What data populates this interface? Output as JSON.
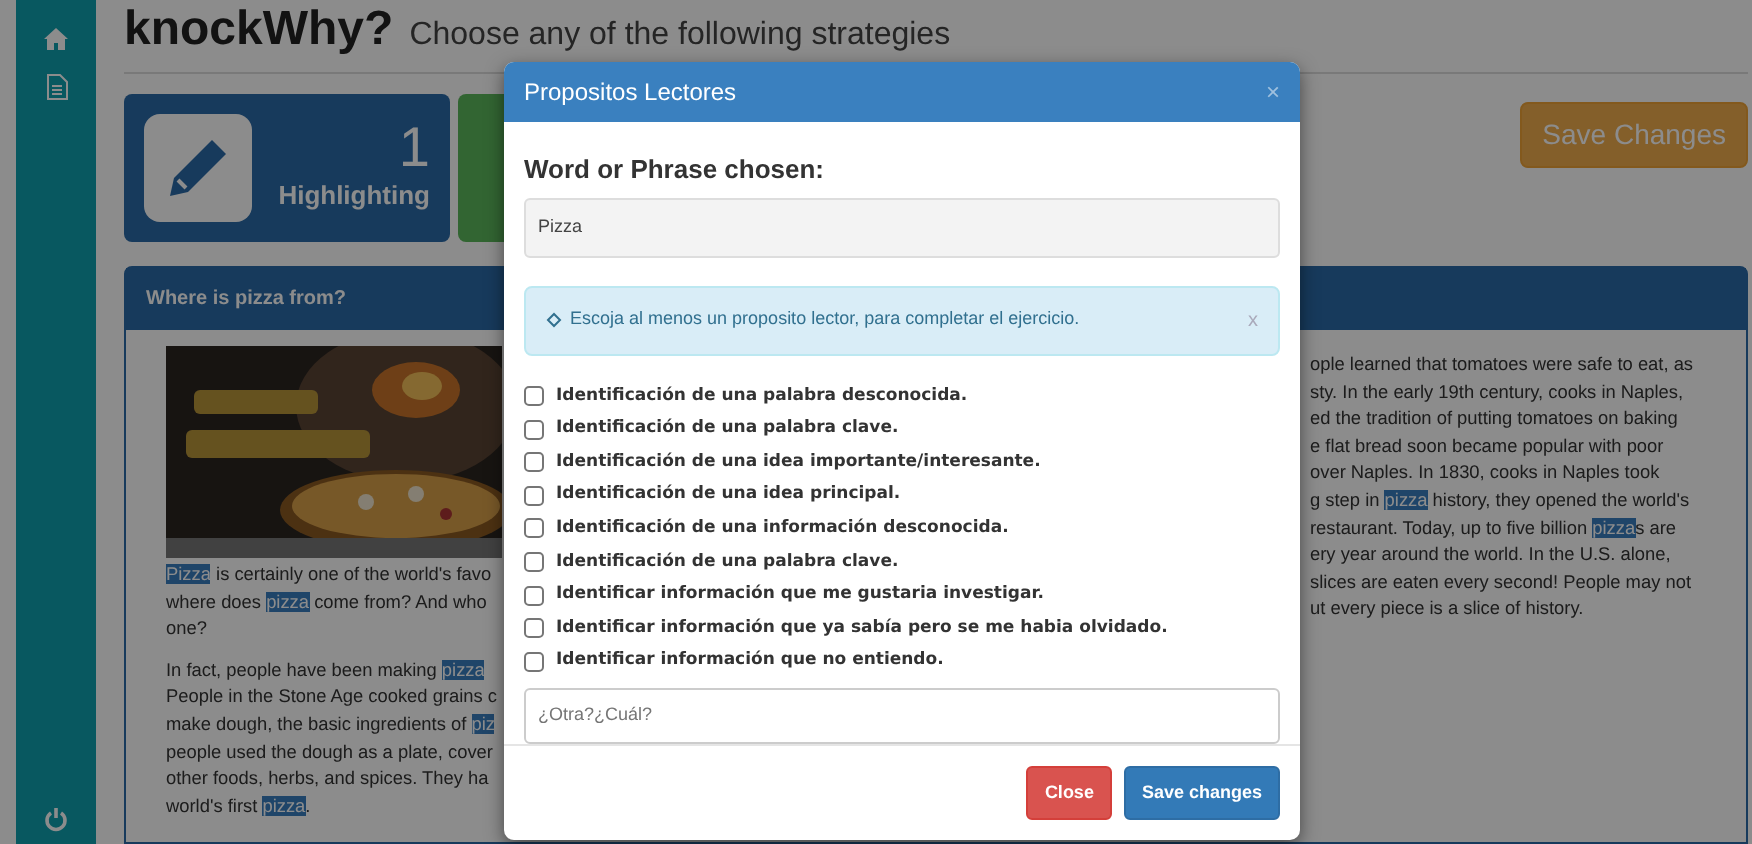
{
  "header": {
    "title": "knockWhy?",
    "subtitle": "Choose any of the following strategies"
  },
  "strategy_cards": [
    {
      "count": "1",
      "label": "Highlighting"
    }
  ],
  "save_button": {
    "label": "Save Changes"
  },
  "panel": {
    "title": "Where is pizza from?",
    "image": {
      "kind": "picture"
    },
    "left_paragraphs": [
      [
        [
          {
            "text": "Pizza",
            "highlighted": true
          },
          {
            "text": " is certainly one of the world's favo",
            "highlighted": false
          }
        ],
        [
          {
            "text": "where does ",
            "highlighted": false
          },
          {
            "text": "pizza",
            "highlighted": true
          },
          {
            "text": " come from? And who",
            "highlighted": false
          }
        ],
        [
          {
            "text": "one?",
            "highlighted": false
          }
        ]
      ],
      [
        [
          {
            "text": "In fact, people have been making ",
            "highlighted": false
          },
          {
            "text": "pizza",
            "highlighted": true
          }
        ],
        [
          {
            "text": "People in the Stone Age cooked grains c",
            "highlighted": false
          }
        ],
        [
          {
            "text": "make dough, the basic ingredients of ",
            "highlighted": false
          },
          {
            "text": "piz",
            "highlighted": true
          }
        ],
        [
          {
            "text": "people used the dough as a plate, cover",
            "highlighted": false
          }
        ],
        [
          {
            "text": "other foods, herbs, and spices. They ha",
            "highlighted": false
          }
        ],
        [
          {
            "text": "world's first ",
            "highlighted": false
          },
          {
            "text": "pizza",
            "highlighted": true
          },
          {
            "text": ".",
            "highlighted": false
          }
        ]
      ]
    ],
    "right_lines": [
      [
        {
          "text": "ople learned that tomatoes were safe to eat, as",
          "highlighted": false
        }
      ],
      [
        {
          "text": "sty. In the early 19th century, cooks in Naples,",
          "highlighted": false
        }
      ],
      [
        {
          "text": "ed the tradition of putting tomatoes on baking",
          "highlighted": false
        }
      ],
      [
        {
          "text": "e flat bread soon became popular with poor",
          "highlighted": false
        }
      ],
      [
        {
          "text": "over Naples. In 1830, cooks in Naples took",
          "highlighted": false
        }
      ],
      [
        {
          "text": "g step in ",
          "highlighted": false
        },
        {
          "text": "pizza",
          "highlighted": true
        },
        {
          "text": " history, they opened the world's",
          "highlighted": false
        }
      ],
      [
        {
          "text": "restaurant. Today, up to five billion ",
          "highlighted": false
        },
        {
          "text": "pizza",
          "highlighted": true
        },
        {
          "text": "s are",
          "highlighted": false
        }
      ],
      [
        {
          "text": "ery year around the world. In the U.S. alone,",
          "highlighted": false
        }
      ],
      [
        {
          "text": "slices are eaten every second! People may not",
          "highlighted": false
        }
      ],
      [
        {
          "text": "ut every piece is a slice of history.",
          "highlighted": false
        }
      ]
    ]
  },
  "modal": {
    "title": "Propositos Lectores",
    "close_glyph": "×",
    "field_label": "Word or Phrase chosen:",
    "field_value": "Pizza",
    "alert": {
      "text": "Escoja al menos un proposito lector, para completar el ejercicio.",
      "close_glyph": "x"
    },
    "options": [
      {
        "label": "Identificación de una palabra desconocida.",
        "checked": false
      },
      {
        "label": "Identificación de una palabra clave.",
        "checked": false
      },
      {
        "label": "Identificación de una idea importante/interesante.",
        "checked": false
      },
      {
        "label": "Identificación de una idea principal.",
        "checked": false
      },
      {
        "label": "Identificación de una información desconocida.",
        "checked": false
      },
      {
        "label": "Identificación de una palabra clave.",
        "checked": false
      },
      {
        "label": "Identificar información que me gustaria investigar.",
        "checked": false
      },
      {
        "label": "Identificar información que ya sabía pero se me habia olvidado.",
        "checked": false
      },
      {
        "label": "Identificar información que no entiendo.",
        "checked": false
      }
    ],
    "other": {
      "placeholder": "¿Otra?¿Cuál?"
    },
    "buttons": [
      {
        "label": "Close",
        "kind": "danger"
      },
      {
        "label": "Save changes",
        "kind": "primary"
      }
    ]
  }
}
